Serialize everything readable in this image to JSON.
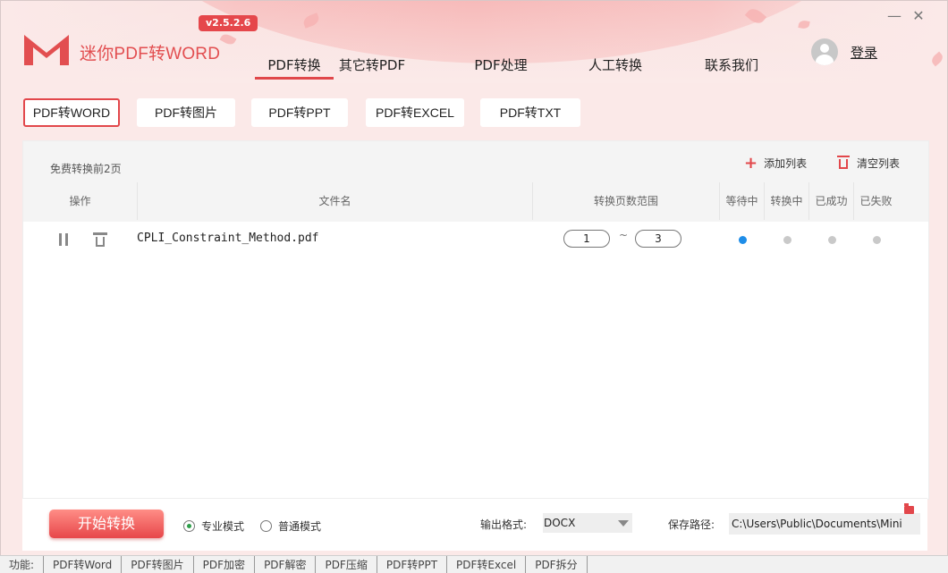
{
  "app": {
    "title": "迷你PDF转WORD",
    "version": "v2.5.2.6",
    "login": "登录",
    "brand_color": "#e2474b"
  },
  "window_controls": {
    "minimize": "—",
    "close": "✕"
  },
  "nav": {
    "tabs": [
      {
        "label": "PDF转换",
        "active": true
      },
      {
        "label": "其它转PDF"
      },
      {
        "label": "PDF处理"
      },
      {
        "label": "人工转换"
      },
      {
        "label": "联系我们"
      }
    ]
  },
  "subtabs": [
    {
      "label": "PDF转WORD",
      "active": true
    },
    {
      "label": "PDF转图片"
    },
    {
      "label": "PDF转PPT"
    },
    {
      "label": "PDF转EXCEL"
    },
    {
      "label": "PDF转TXT"
    }
  ],
  "list": {
    "free_note": "免费转换前2页",
    "add_label": "添加列表",
    "clear_label": "清空列表",
    "columns": [
      "操作",
      "文件名",
      "转换页数范围",
      "等待中",
      "转换中",
      "已成功",
      "已失败"
    ],
    "rows": [
      {
        "filename": "CPLI_Constraint_Method.pdf",
        "page_from": "1",
        "page_to": "3",
        "separator": "~",
        "status": "等待中"
      }
    ]
  },
  "bottom": {
    "start_button": "开始转换",
    "mode_pro": "专业模式",
    "mode_normal": "普通模式",
    "selected_mode": "专业模式",
    "output_format_label": "输出格式:",
    "output_format_value": "DOCX",
    "save_path_label": "保存路径:",
    "save_path_value": "C:\\Users\\Public\\Documents\\Mini"
  },
  "taskbar_text": [
    "功能:",
    "PDF转Word",
    "PDF转图片",
    "PDF加密",
    "PDF解密",
    "PDF压缩",
    "PDF转PPT",
    "PDF转Excel",
    "PDF拆分"
  ]
}
